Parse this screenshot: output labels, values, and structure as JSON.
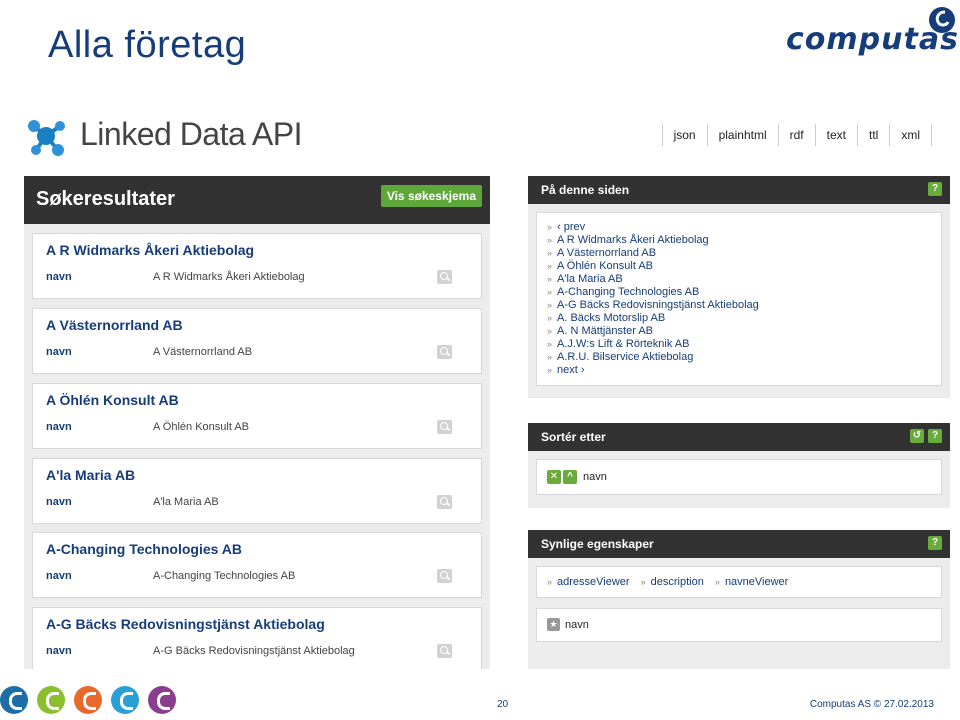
{
  "slide": {
    "title": "Alla företag",
    "page_number": "20",
    "credit": "Computas AS © 27.02.2013"
  },
  "brand": {
    "name": "computas",
    "color": "#163d7a"
  },
  "app": {
    "logo_icon": "linked-data-icon",
    "title": "Linked Data API",
    "formats": [
      "json",
      "plainhtml",
      "rdf",
      "text",
      "ttl",
      "xml"
    ]
  },
  "results": {
    "title": "Søkeresultater",
    "toggle_label": "Vis søkeskjema",
    "items": [
      {
        "name": "A R Widmarks Åkeri Aktiebolag",
        "prop": "navn",
        "value": "A R Widmarks Åkeri Aktiebolag"
      },
      {
        "name": "A Västernorrland AB",
        "prop": "navn",
        "value": "A Västernorrland AB"
      },
      {
        "name": "A Öhlén Konsult AB",
        "prop": "navn",
        "value": "A Öhlén Konsult AB"
      },
      {
        "name": "A'la Maria AB",
        "prop": "navn",
        "value": "A'la Maria AB"
      },
      {
        "name": "A-Changing Technologies AB",
        "prop": "navn",
        "value": "A-Changing Technologies AB"
      },
      {
        "name": "A-G Bäcks Redovisningstjänst Aktiebolag",
        "prop": "navn",
        "value": "A-G Bäcks Redovisningstjänst Aktiebolag"
      }
    ]
  },
  "on_page": {
    "title": "På denne siden",
    "help": "?",
    "links": [
      "‹ prev",
      "A R Widmarks Åkeri Aktiebolag",
      "A Västernorrland AB",
      "A Öhlén Konsult AB",
      "A'la Maria AB",
      "A-Changing Technologies AB",
      "A-G Bäcks Redovisningstjänst Aktiebolag",
      "A. Bäcks Motorslip AB",
      "A. N Mättjänster AB",
      "A.J.W:s Lift & Rörteknik AB",
      "A.R.U. Bilservice Aktiebolag",
      "next ›"
    ]
  },
  "sort": {
    "title": "Sortér etter",
    "help": "?",
    "undo": "↺",
    "remove": "✕",
    "direction": "^",
    "field": "navn"
  },
  "visible_props": {
    "title": "Synlige egenskaper",
    "help": "?",
    "chain": [
      "adresseViewer",
      "description",
      "navneViewer"
    ],
    "star": "★",
    "selected": "navn"
  },
  "footer": {
    "icon_colors": [
      "#1d6ea8",
      "#8cbf2e",
      "#e8692c",
      "#2a9ed6",
      "#8a3f8e"
    ]
  }
}
